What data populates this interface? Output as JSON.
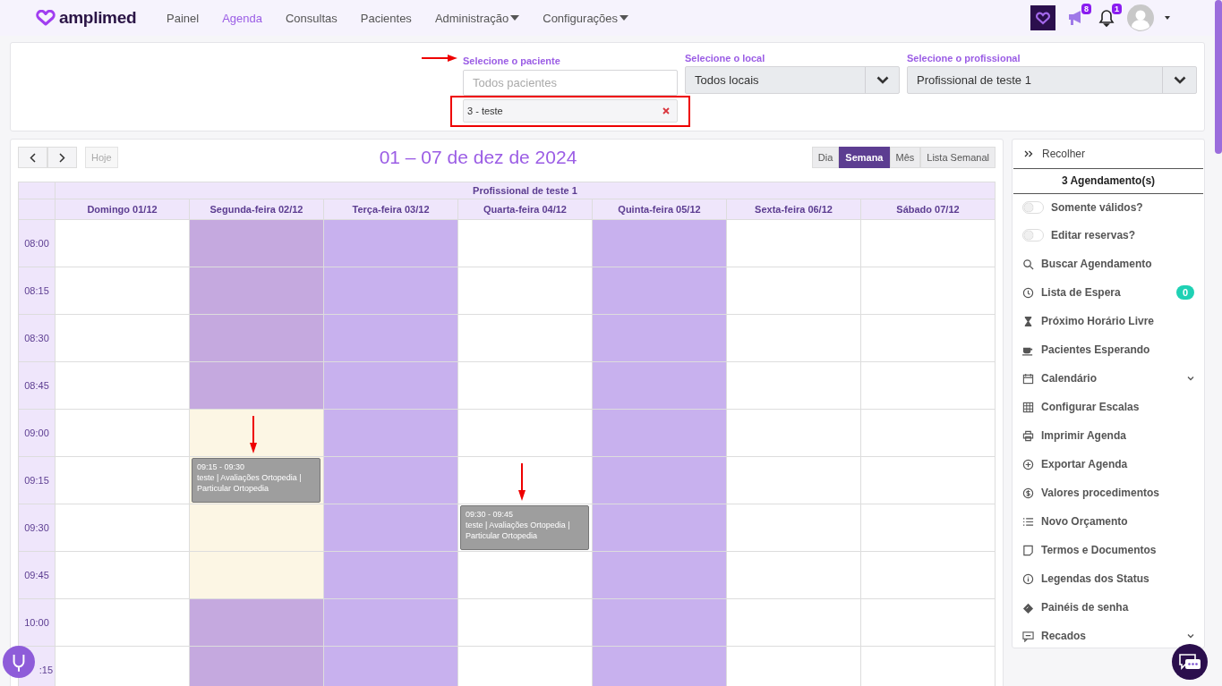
{
  "topbar": {
    "brand": "amplimed",
    "nav": [
      {
        "label": "Painel",
        "selected": false,
        "dropdown": false
      },
      {
        "label": "Agenda",
        "selected": true,
        "dropdown": false
      },
      {
        "label": "Consultas",
        "selected": false,
        "dropdown": false
      },
      {
        "label": "Pacientes",
        "selected": false,
        "dropdown": false
      },
      {
        "label": "Administração",
        "selected": false,
        "dropdown": true
      },
      {
        "label": "Configurações",
        "selected": false,
        "dropdown": true
      }
    ],
    "megaphone_badge": "8",
    "notification_badge": "1"
  },
  "filters": {
    "patient": {
      "label": "Selecione o paciente",
      "placeholder": "Todos pacientes",
      "annotated": true,
      "tags": [
        {
          "label": "3 - teste"
        }
      ]
    },
    "location": {
      "label": "Selecione o local",
      "value": "Todos locais"
    },
    "professional": {
      "label": "Selecione o profissional",
      "value": "Profissional de teste 1"
    }
  },
  "calendar": {
    "today": {
      "label": "Hoje",
      "disabled": true
    },
    "title": "01 – 07 de dez de 2024",
    "views": [
      {
        "label": "Dia",
        "selected": false
      },
      {
        "label": "Semana",
        "selected": true
      },
      {
        "label": "Mês",
        "selected": false
      },
      {
        "label": "Lista Semanal",
        "selected": false
      }
    ],
    "resource": "Profissional de teste 1",
    "times": [
      "08:00",
      "08:15",
      "08:30",
      "08:45",
      "09:00",
      "09:15",
      "09:30",
      "09:45",
      "10:00",
      ":15"
    ],
    "days": [
      {
        "label": "Domingo 01/12",
        "slots": [
          {
            "kind": "free"
          },
          {
            "kind": "free"
          },
          {
            "kind": "free"
          },
          {
            "kind": "free"
          },
          {
            "kind": "free"
          },
          {
            "kind": "free"
          },
          {
            "kind": "free"
          },
          {
            "kind": "free"
          },
          {
            "kind": "free"
          },
          {
            "kind": "free"
          }
        ]
      },
      {
        "label": "Segunda-feira 02/12",
        "slots": [
          {
            "kind": "blocked"
          },
          {
            "kind": "blocked"
          },
          {
            "kind": "blocked"
          },
          {
            "kind": "blocked"
          },
          {
            "kind": "available"
          },
          {
            "kind": "available",
            "event": {
              "time": "09:15 - 09:30",
              "text": "teste | Avaliações Ortopedia | Particular Ortopedia",
              "annotated": true
            }
          },
          {
            "kind": "available"
          },
          {
            "kind": "available"
          },
          {
            "kind": "blocked"
          },
          {
            "kind": "blocked"
          }
        ]
      },
      {
        "label": "Terça-feira 03/12",
        "slots": [
          {
            "kind": "off"
          },
          {
            "kind": "off"
          },
          {
            "kind": "off"
          },
          {
            "kind": "off"
          },
          {
            "kind": "off"
          },
          {
            "kind": "off"
          },
          {
            "kind": "off"
          },
          {
            "kind": "off"
          },
          {
            "kind": "off"
          },
          {
            "kind": "off"
          }
        ]
      },
      {
        "label": "Quarta-feira 04/12",
        "slots": [
          {
            "kind": "free"
          },
          {
            "kind": "free"
          },
          {
            "kind": "free"
          },
          {
            "kind": "free"
          },
          {
            "kind": "free"
          },
          {
            "kind": "free"
          },
          {
            "kind": "free",
            "event": {
              "time": "09:30 - 09:45",
              "text": "teste | Avaliações Ortopedia | Particular Ortopedia",
              "annotated": true
            }
          },
          {
            "kind": "free"
          },
          {
            "kind": "free"
          },
          {
            "kind": "free"
          }
        ]
      },
      {
        "label": "Quinta-feira 05/12",
        "slots": [
          {
            "kind": "off"
          },
          {
            "kind": "off"
          },
          {
            "kind": "off"
          },
          {
            "kind": "off"
          },
          {
            "kind": "off"
          },
          {
            "kind": "off"
          },
          {
            "kind": "off"
          },
          {
            "kind": "off"
          },
          {
            "kind": "off"
          },
          {
            "kind": "off"
          }
        ]
      },
      {
        "label": "Sexta-feira 06/12",
        "slots": [
          {
            "kind": "free"
          },
          {
            "kind": "free"
          },
          {
            "kind": "free"
          },
          {
            "kind": "free"
          },
          {
            "kind": "free"
          },
          {
            "kind": "free"
          },
          {
            "kind": "free"
          },
          {
            "kind": "free"
          },
          {
            "kind": "free"
          },
          {
            "kind": "free"
          }
        ]
      },
      {
        "label": "Sábado 07/12",
        "slots": [
          {
            "kind": "free"
          },
          {
            "kind": "free"
          },
          {
            "kind": "free"
          },
          {
            "kind": "free"
          },
          {
            "kind": "free"
          },
          {
            "kind": "free"
          },
          {
            "kind": "free"
          },
          {
            "kind": "free"
          },
          {
            "kind": "free"
          },
          {
            "kind": "free"
          }
        ]
      }
    ]
  },
  "sidebar": {
    "collapse": "Recolher",
    "count": "3 Agendamento(s)",
    "items": [
      {
        "kind": "toggle",
        "label": "Somente válidos?",
        "on": false
      },
      {
        "kind": "toggle",
        "label": "Editar reservas?",
        "on": false
      },
      {
        "kind": "link",
        "label": "Buscar Agendamento"
      },
      {
        "kind": "link",
        "label": "Lista de Espera",
        "badge": "0"
      },
      {
        "kind": "link",
        "label": "Próximo Horário Livre"
      },
      {
        "kind": "link",
        "label": "Pacientes Esperando"
      },
      {
        "kind": "menu",
        "label": "Calendário",
        "expanded": false
      },
      {
        "kind": "link",
        "label": "Configurar Escalas"
      },
      {
        "kind": "link",
        "label": "Imprimir Agenda"
      },
      {
        "kind": "link",
        "label": "Exportar Agenda"
      },
      {
        "kind": "link",
        "label": "Valores procedimentos"
      },
      {
        "kind": "link",
        "label": "Novo Orçamento"
      },
      {
        "kind": "link",
        "label": "Termos e Documentos"
      },
      {
        "kind": "link",
        "label": "Legendas dos Status"
      },
      {
        "kind": "link",
        "label": "Painéis de senha"
      },
      {
        "kind": "menu",
        "label": "Recados",
        "expanded": false
      }
    ]
  }
}
